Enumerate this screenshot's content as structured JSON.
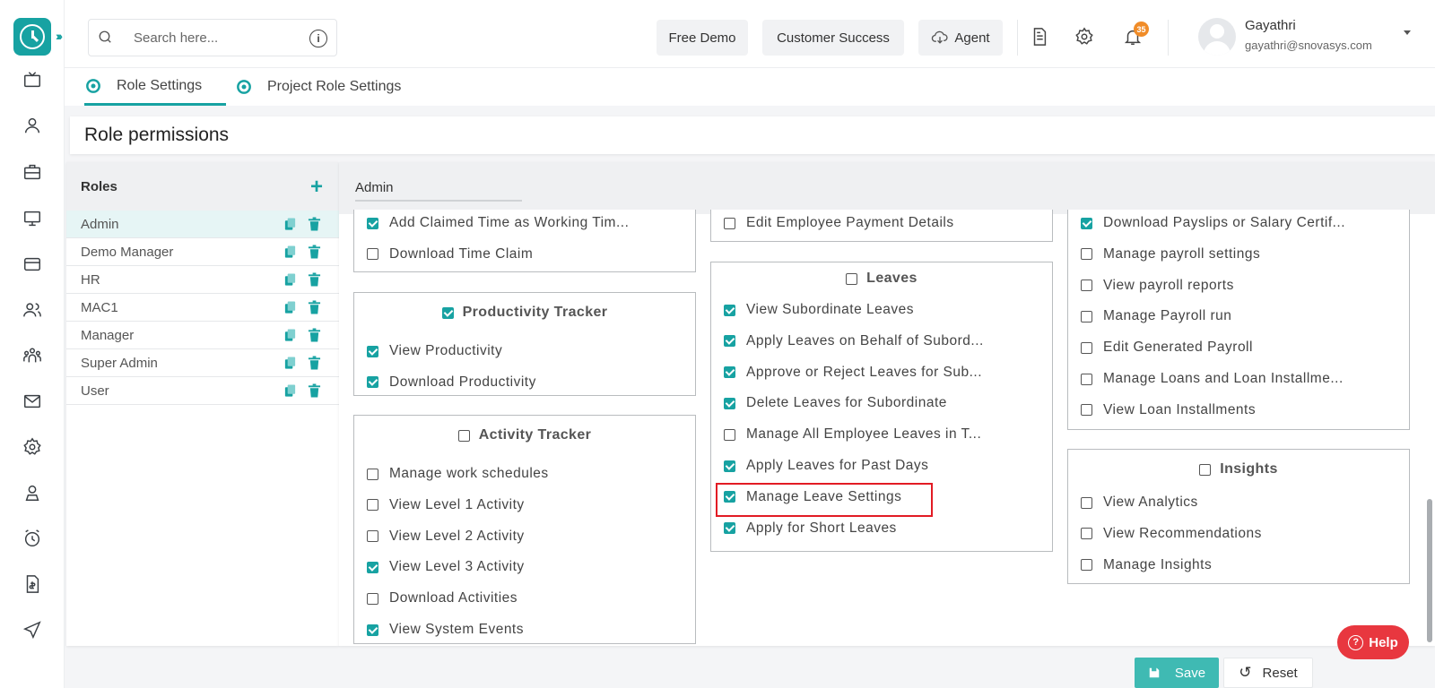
{
  "header": {
    "search_placeholder": "Search here...",
    "buttons": {
      "free_demo": "Free Demo",
      "customer_success": "Customer Success",
      "agent": "Agent"
    },
    "notification_count": "35",
    "user": {
      "name": "Gayathri",
      "email": "gayathri@snovasys.com"
    }
  },
  "tabs": {
    "role_settings": "Role Settings",
    "project_role_settings": "Project Role Settings"
  },
  "page_title": "Role permissions",
  "roles": {
    "header": "Roles",
    "items": [
      "Admin",
      "Demo Manager",
      "HR",
      "MAC1",
      "Manager",
      "Super Admin",
      "User"
    ],
    "selected": "Admin"
  },
  "permissions": {
    "selected_role": "Admin",
    "time_claim": {
      "items": [
        {
          "label": "Add Claimed Time as Working Tim...",
          "checked": true
        },
        {
          "label": "Download Time Claim",
          "checked": false
        }
      ]
    },
    "productivity": {
      "title": "Productivity Tracker",
      "checked": true,
      "items": [
        {
          "label": "View Productivity",
          "checked": true
        },
        {
          "label": "Download Productivity",
          "checked": true
        }
      ]
    },
    "activity": {
      "title": "Activity Tracker",
      "checked": false,
      "items": [
        {
          "label": "Manage work schedules",
          "checked": false
        },
        {
          "label": "View Level 1 Activity",
          "checked": false
        },
        {
          "label": "View Level 2 Activity",
          "checked": false
        },
        {
          "label": "View Level 3 Activity",
          "checked": true
        },
        {
          "label": "Download Activities",
          "checked": false
        },
        {
          "label": "View System Events",
          "checked": true
        }
      ]
    },
    "payment": {
      "items": [
        {
          "label": "Edit Employee Payment Details",
          "checked": false
        }
      ]
    },
    "leaves": {
      "title": "Leaves",
      "checked": false,
      "items": [
        {
          "label": "View Subordinate Leaves",
          "checked": true
        },
        {
          "label": "Apply Leaves on Behalf of Subord...",
          "checked": true
        },
        {
          "label": "Approve or Reject Leaves for Sub...",
          "checked": true
        },
        {
          "label": "Delete Leaves for Subordinate",
          "checked": true
        },
        {
          "label": "Manage All Employee Leaves in T...",
          "checked": false
        },
        {
          "label": "Apply Leaves for Past Days",
          "checked": true
        },
        {
          "label": "Manage Leave Settings",
          "checked": true
        },
        {
          "label": "Apply for Short Leaves",
          "checked": true
        }
      ]
    },
    "payroll": {
      "items": [
        {
          "label": "Download Payslips or Salary Certif...",
          "checked": true
        },
        {
          "label": "Manage payroll settings",
          "checked": false
        },
        {
          "label": "View payroll reports",
          "checked": false
        },
        {
          "label": "Manage Payroll run",
          "checked": false
        },
        {
          "label": "Edit Generated Payroll",
          "checked": false
        },
        {
          "label": "Manage Loans and Loan Installme...",
          "checked": false
        },
        {
          "label": "View Loan Installments",
          "checked": false
        }
      ]
    },
    "insights": {
      "title": "Insights",
      "checked": false,
      "items": [
        {
          "label": "View Analytics",
          "checked": false
        },
        {
          "label": "View Recommendations",
          "checked": false
        },
        {
          "label": "Manage Insights",
          "checked": false
        }
      ]
    }
  },
  "help_label": "Help",
  "footer": {
    "save": "Save",
    "reset": "Reset"
  },
  "colors": {
    "accent": "#17a2a2",
    "highlight": "#e21b24",
    "help": "#e8373f",
    "save": "#3fbab3"
  }
}
